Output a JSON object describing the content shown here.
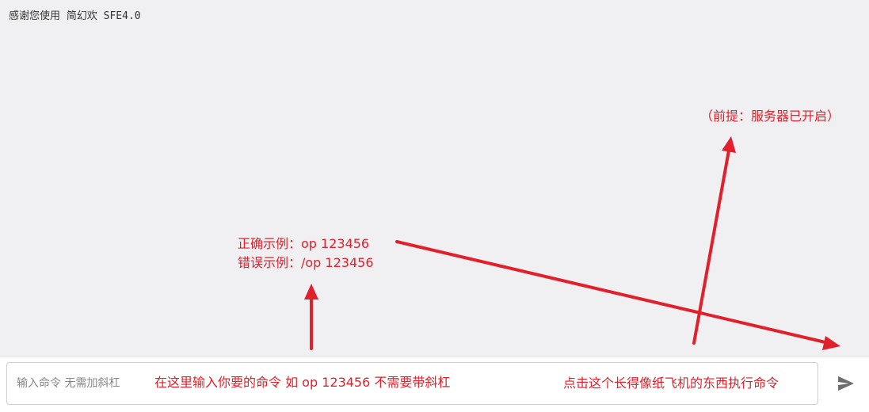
{
  "console": {
    "line": "感谢您使用 简幻欢 SFE4.0"
  },
  "input": {
    "placeholder": "输入命令 无需加斜杠",
    "value": ""
  },
  "icons": {
    "send": "send-icon"
  },
  "annotations": {
    "color": "#e0202a",
    "correct_example": "正确示例：op 123456",
    "wrong_example": "错误示例：/op 123456",
    "premise": "（前提：服务器已开启）",
    "input_hint": "在这里输入你要的命令 如 op 123456 不需要带斜杠",
    "send_hint": "点击这个长得像纸飞机的东西执行命令"
  }
}
